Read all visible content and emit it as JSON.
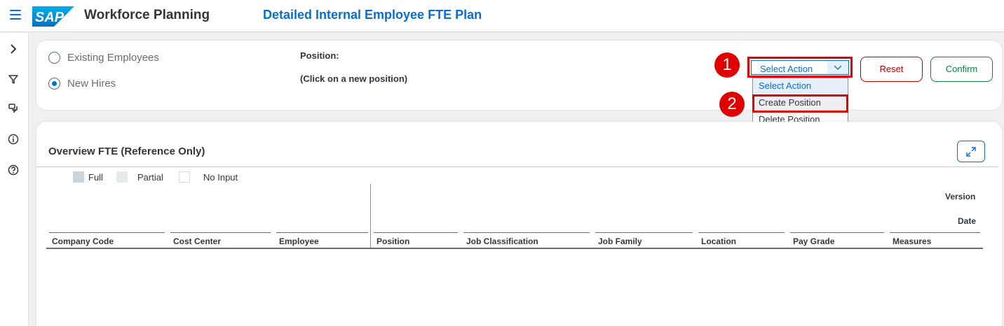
{
  "header": {
    "app_title": "Workforce Planning",
    "page_title": "Detailed Internal Employee FTE Plan",
    "logo_text": "SAP"
  },
  "sidebar": {
    "icons": [
      "chevron-right-icon",
      "filter-icon",
      "comments-icon",
      "info-icon",
      "help-icon"
    ]
  },
  "employee_type": {
    "options": [
      "Existing Employees",
      "New Hires"
    ],
    "selected": "New Hires"
  },
  "position": {
    "label": "Position:",
    "hint": "(Click on a new position)"
  },
  "actions": {
    "select_value": "Select Action",
    "dropdown_options": [
      "Select Action",
      "Create Position",
      "Delete Position"
    ],
    "reset_label": "Reset",
    "confirm_label": "Confirm"
  },
  "annotations": {
    "step1": "1",
    "step2": "2",
    "highlight_color": "#e00000"
  },
  "overview": {
    "title": "Overview FTE (Reference Only)",
    "legend": [
      "Full",
      "Partial",
      "No Input"
    ],
    "version_label": "Version",
    "date_label": "Date",
    "columns": [
      "Company Code",
      "Cost Center",
      "Employee",
      "Position",
      "Job Classification",
      "Job Family",
      "Location",
      "Pay Grade",
      "Measures"
    ]
  },
  "colors": {
    "brand": "#0a6ed1",
    "reject": "#bb0000",
    "accept": "#107e3e"
  }
}
